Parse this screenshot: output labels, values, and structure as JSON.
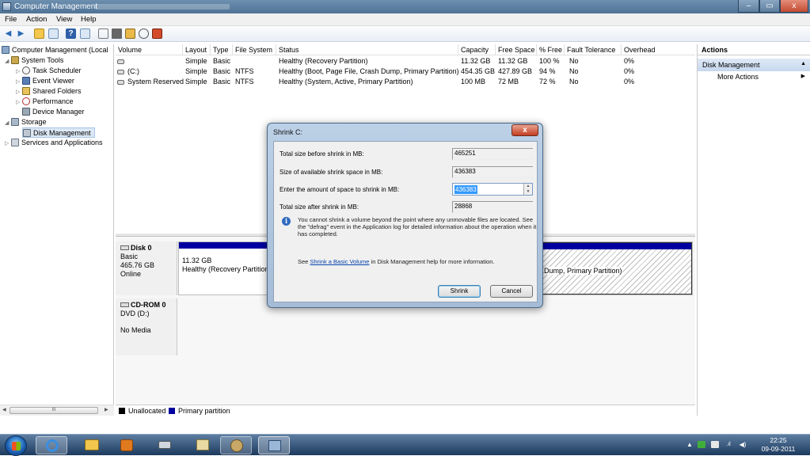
{
  "window": {
    "title": "Computer Management",
    "controls": {
      "minimize": "–",
      "maximize": "▭",
      "close": "x"
    }
  },
  "menu": [
    "File",
    "Action",
    "View",
    "Help"
  ],
  "tree": {
    "root": "Computer Management (Local",
    "system_tools": "System Tools",
    "task_scheduler": "Task Scheduler",
    "event_viewer": "Event Viewer",
    "shared_folders": "Shared Folders",
    "performance": "Performance",
    "device_manager": "Device Manager",
    "storage": "Storage",
    "disk_management": "Disk Management",
    "services": "Services and Applications",
    "scroll_thumb": "III"
  },
  "volumes": {
    "headers": [
      "Volume",
      "Layout",
      "Type",
      "File System",
      "Status",
      "Capacity",
      "Free Space",
      "% Free",
      "Fault Tolerance",
      "Overhead"
    ],
    "rows": [
      {
        "volume": "",
        "layout": "Simple",
        "type": "Basic",
        "fs": "",
        "status": "Healthy (Recovery Partition)",
        "capacity": "11.32 GB",
        "free": "11.32 GB",
        "pct": "100 %",
        "fault": "No",
        "overhead": "0%"
      },
      {
        "volume": "(C:)",
        "layout": "Simple",
        "type": "Basic",
        "fs": "NTFS",
        "status": "Healthy (Boot, Page File, Crash Dump, Primary Partition)",
        "capacity": "454.35 GB",
        "free": "427.89 GB",
        "pct": "94 %",
        "fault": "No",
        "overhead": "0%"
      },
      {
        "volume": "System Reserved",
        "layout": "Simple",
        "type": "Basic",
        "fs": "NTFS",
        "status": "Healthy (System, Active, Primary Partition)",
        "capacity": "100 MB",
        "free": "72 MB",
        "pct": "72 %",
        "fault": "No",
        "overhead": "0%"
      }
    ]
  },
  "disks": {
    "disk0": {
      "name": "Disk 0",
      "type": "Basic",
      "size": "465.76 GB",
      "state": "Online",
      "partition1": {
        "size": "11.32 GB",
        "status": "Healthy (Recovery Partition"
      },
      "partition2": {
        "status": "Dump, Primary Partition)"
      }
    },
    "cdrom": {
      "name": "CD-ROM 0",
      "drive": "DVD (D:)",
      "media": "No Media"
    }
  },
  "legend": {
    "unallocated": "Unallocated",
    "primary": "Primary partition"
  },
  "actions": {
    "title": "Actions",
    "section": "Disk Management",
    "more": "More Actions"
  },
  "dialog": {
    "title": "Shrink C:",
    "total_before_label": "Total size before shrink in MB:",
    "total_before_value": "465251",
    "available_label": "Size of available shrink space in MB:",
    "available_value": "436383",
    "enter_label": "Enter the amount of space to shrink in MB:",
    "enter_value": "436383",
    "total_after_label": "Total size after shrink in MB:",
    "total_after_value": "28868",
    "info_text": "You cannot shrink a volume beyond the point where any unmovable files are located. See the \"defrag\" event in the Application log for detailed information about the operation when it has completed.",
    "see_prefix": "See ",
    "see_link": "Shrink a Basic Volume",
    "see_suffix": " in Disk Management help for more information.",
    "shrink_button": "Shrink",
    "cancel_button": "Cancel",
    "close_glyph": "x"
  },
  "taskbar": {
    "time": "22:25",
    "date": "09-09-2011"
  },
  "colors": {
    "primary_partition": "#0000a0",
    "unallocated": "#000000",
    "selection": "#3399ff"
  }
}
